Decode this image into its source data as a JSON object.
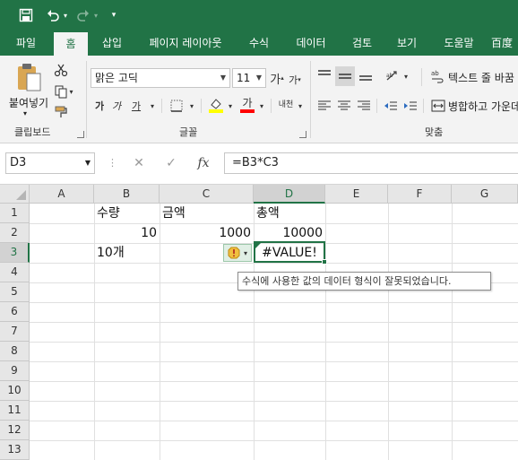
{
  "qat": {
    "save_icon": "save-icon",
    "undo_icon": "undo-icon",
    "redo_icon": "redo-icon",
    "customize_icon": "chevron-down-icon"
  },
  "tabs": [
    {
      "label": "파일"
    },
    {
      "label": "홈"
    },
    {
      "label": "삽입"
    },
    {
      "label": "페이지 레이아웃"
    },
    {
      "label": "수식"
    },
    {
      "label": "데이터"
    },
    {
      "label": "검토"
    },
    {
      "label": "보기"
    },
    {
      "label": "도움말"
    },
    {
      "label": "百度"
    }
  ],
  "ribbon": {
    "clipboard": {
      "paste_label": "붙여넣기",
      "group_label": "클립보드"
    },
    "font": {
      "font_name": "맑은 고딕",
      "font_size": "11",
      "group_label": "글꼴",
      "bold": "가",
      "italic": "가",
      "underline": "가",
      "font_color_label": "가",
      "grow": "가",
      "shrink": "가",
      "phonetic": "내천"
    },
    "alignment": {
      "wrap_text_label": "텍스트 줄 바꿈",
      "merge_label": "병합하고 가운데",
      "group_label": "맞춤"
    }
  },
  "formula_bar": {
    "name_box": "D3",
    "cancel": "✕",
    "enter": "✓",
    "fx": "fx",
    "formula": "=B3*C3"
  },
  "grid": {
    "columns": [
      "A",
      "B",
      "C",
      "D",
      "E",
      "F",
      "G"
    ],
    "rows": [
      "1",
      "2",
      "3",
      "4",
      "5",
      "6",
      "7",
      "8",
      "9",
      "10",
      "11",
      "12",
      "13"
    ],
    "cells": {
      "B1": "수량",
      "C1": "금액",
      "D1": "총액",
      "B2": "10",
      "C2": "1000",
      "D2": "10000",
      "B3": "10개",
      "D3": "#VALUE!"
    },
    "error_tooltip": "수식에 사용한 값의 데이터 형식이 잘못되었습니다."
  },
  "colors": {
    "brand": "#217346",
    "error_fill": "#e0efe5"
  }
}
